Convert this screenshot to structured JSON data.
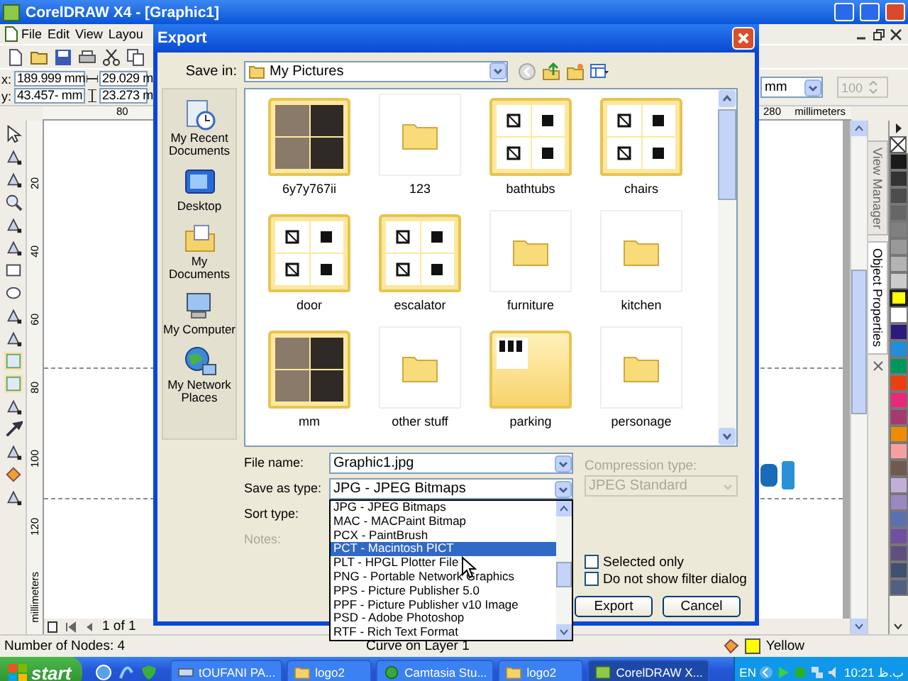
{
  "app": {
    "title": "CorelDRAW X4 - [Graphic1]"
  },
  "menu": [
    "File",
    "Edit",
    "View",
    "Layou"
  ],
  "property_bar": {
    "x_label": "x:",
    "x": "189.999 mm",
    "y_label": "y:",
    "y": "43.457- mm",
    "width": "29.029 m",
    "height": "23.273 m",
    "outline_width": "mm",
    "scale": "100"
  },
  "rulers": {
    "top_labels": [
      "80",
      "280"
    ],
    "top_unit": "millimeters",
    "left_labels": [
      "20",
      "40",
      "60",
      "80",
      "100",
      "120"
    ],
    "left_unit": "millimeters"
  },
  "page_nav": "1 of 1",
  "dockers": [
    {
      "label": "View Manager",
      "selected": false
    },
    {
      "label": "Object Properties",
      "selected": true
    }
  ],
  "palette": [
    {
      "color": "#1a1a1a",
      "selected": false
    },
    {
      "color": "#333333",
      "selected": false
    },
    {
      "color": "#4d4d4d",
      "selected": false
    },
    {
      "color": "#666666",
      "selected": false
    },
    {
      "color": "#808080",
      "selected": false
    },
    {
      "color": "#999999",
      "selected": false
    },
    {
      "color": "#b3b3b3",
      "selected": false
    },
    {
      "color": "#cccccc",
      "selected": false
    },
    {
      "color": "#ffff00",
      "selected": true
    },
    {
      "color": "#ffffff",
      "selected": false
    },
    {
      "color": "#2e1a7a",
      "selected": false
    },
    {
      "color": "#1e8fd8",
      "selected": false
    },
    {
      "color": "#00985a",
      "selected": false
    },
    {
      "color": "#e84010",
      "selected": false
    },
    {
      "color": "#e8287a",
      "selected": false
    },
    {
      "color": "#a83870",
      "selected": false
    },
    {
      "color": "#f08a00",
      "selected": false
    },
    {
      "color": "#f5a0a0",
      "selected": false
    },
    {
      "color": "#705a50",
      "selected": false
    },
    {
      "color": "#c0b0d8",
      "selected": false
    },
    {
      "color": "#9a88c0",
      "selected": false
    },
    {
      "color": "#5a70b0",
      "selected": false
    },
    {
      "color": "#7050a0",
      "selected": false
    },
    {
      "color": "#605080",
      "selected": false
    },
    {
      "color": "#405070",
      "selected": false
    },
    {
      "color": "#506080",
      "selected": false
    }
  ],
  "status_bar": {
    "nodes": "Number of Nodes: 4",
    "layer": "Curve on Layer 1",
    "fill_name": "Yellow"
  },
  "dialog": {
    "title": "Export",
    "save_in_label": "Save in:",
    "save_in": "My Pictures",
    "places": [
      {
        "label": "My Recent Documents",
        "kind": "recent"
      },
      {
        "label": "Desktop",
        "kind": "desktop"
      },
      {
        "label": "My Documents",
        "kind": "documents"
      },
      {
        "label": "My Computer",
        "kind": "computer"
      },
      {
        "label": "My Network Places",
        "kind": "network"
      }
    ],
    "files": [
      {
        "name": "6y7y767ii",
        "kind": "photos"
      },
      {
        "name": "123",
        "kind": "empty"
      },
      {
        "name": "bathtubs",
        "kind": "drawings"
      },
      {
        "name": "chairs",
        "kind": "drawings"
      },
      {
        "name": "door",
        "kind": "drawings"
      },
      {
        "name": "escalator",
        "kind": "drawings"
      },
      {
        "name": "furniture",
        "kind": "empty"
      },
      {
        "name": "kitchen",
        "kind": "empty"
      },
      {
        "name": "mm",
        "kind": "photos"
      },
      {
        "name": "other stuff",
        "kind": "empty"
      },
      {
        "name": "parking",
        "kind": "single"
      },
      {
        "name": "personage",
        "kind": "empty"
      }
    ],
    "file_name_label": "File name:",
    "file_name": "Graphic1.jpg",
    "type_label": "Save as type:",
    "type": "JPG - JPEG Bitmaps",
    "type_options": [
      {
        "label": "JPG - JPEG Bitmaps",
        "selected": false
      },
      {
        "label": "MAC - MACPaint Bitmap",
        "selected": false
      },
      {
        "label": "PCX - PaintBrush",
        "selected": false
      },
      {
        "label": "PCT - Macintosh PICT",
        "selected": true
      },
      {
        "label": "PLT - HPGL Plotter File",
        "selected": false
      },
      {
        "label": "PNG - Portable Network Graphics",
        "selected": false
      },
      {
        "label": "PPS - Picture Publisher 5.0",
        "selected": false
      },
      {
        "label": "PPF - Picture Publisher v10 Image",
        "selected": false
      },
      {
        "label": "PSD - Adobe Photoshop",
        "selected": false
      },
      {
        "label": "RTF - Rich Text Format",
        "selected": false
      }
    ],
    "sort_label": "Sort type:",
    "notes_label": "Notes:",
    "notes_disabled": true,
    "compression_label": "Compression type:",
    "compression": "JPEG Standard",
    "compression_disabled": true,
    "options": [
      {
        "label": "Selected only",
        "checked": false
      },
      {
        "label": "Do not show filter dialog",
        "checked": false
      }
    ],
    "buttons": [
      "Export",
      "Cancel"
    ]
  },
  "taskbar": {
    "start": "start",
    "tasks": [
      {
        "label": "tOUFANI PA...",
        "kind": "app",
        "selected": false
      },
      {
        "label": "logo2",
        "kind": "folder",
        "selected": false
      },
      {
        "label": "Camtasia Stu...",
        "kind": "camtasia",
        "selected": false
      },
      {
        "label": "logo2",
        "kind": "folder",
        "selected": false
      },
      {
        "label": "CorelDRAW X...",
        "kind": "corel",
        "selected": true
      }
    ],
    "language": "EN",
    "clock": "10:21 ب.ظ"
  }
}
